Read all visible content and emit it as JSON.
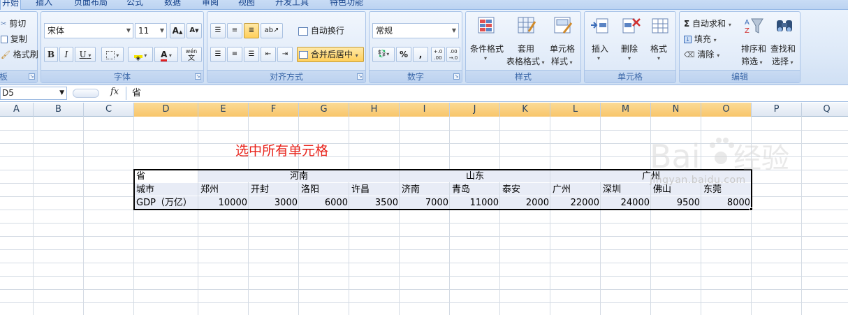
{
  "tabs": [
    "开始",
    "插入",
    "页面布局",
    "公式",
    "数据",
    "审阅",
    "视图",
    "开发工具",
    "特色功能"
  ],
  "clipboard": {
    "cut": "剪切",
    "copy": "复制",
    "format_painter": "格式刷",
    "group_label": "板"
  },
  "font": {
    "name": "宋体",
    "size": "11",
    "bold": "B",
    "italic": "I",
    "underline": "U",
    "grow": "A",
    "shrink": "A",
    "wen": "wén",
    "wen_char": "文",
    "group_label": "字体"
  },
  "alignment": {
    "wrap_text": "自动换行",
    "merge_center": "合并后居中",
    "group_label": "对齐方式"
  },
  "number": {
    "format": "常规",
    "percent": "%",
    "comma": ",",
    "inc_decimal": "+.0 .00",
    "dec_decimal": ".00 →.0",
    "group_label": "数字"
  },
  "styles": {
    "conditional": "条件格式",
    "table_format_1": "套用",
    "table_format_2": "表格格式",
    "cell_style_1": "单元格",
    "cell_style_2": "样式",
    "group_label": "样式"
  },
  "cells": {
    "insert": "插入",
    "delete": "删除",
    "format": "格式",
    "group_label": "单元格"
  },
  "editing": {
    "autosum": "自动求和",
    "fill": "填充",
    "clear": "清除",
    "sort_1": "排序和",
    "sort_2": "筛选",
    "find_1": "查找和",
    "find_2": "选择",
    "group_label": "编辑",
    "sigma": "Σ"
  },
  "formula_bar": {
    "name_box": "D5",
    "fx": "fx",
    "content": "省"
  },
  "columns": [
    "A",
    "B",
    "C",
    "D",
    "E",
    "F",
    "G",
    "H",
    "I",
    "J",
    "K",
    "L",
    "M",
    "N",
    "O",
    "P",
    "Q"
  ],
  "selected_columns": [
    "D",
    "E",
    "F",
    "G",
    "H",
    "I",
    "J",
    "K",
    "L",
    "M",
    "N",
    "O"
  ],
  "note": "选中所有单元格",
  "sheet": {
    "row_province": {
      "label": "省",
      "henan": "河南",
      "shandong": "山东",
      "guangdong": "广州"
    },
    "row_city": {
      "label": "城市",
      "cities": [
        "郑州",
        "开封",
        "洛阳",
        "许昌",
        "济南",
        "青岛",
        "泰安",
        "广州",
        "深圳",
        "佛山",
        "东莞"
      ]
    },
    "row_gdp": {
      "label": "GDP（万亿）",
      "values": [
        "10000",
        "3000",
        "6000",
        "3500",
        "7000",
        "11000",
        "2000",
        "22000",
        "24000",
        "9500",
        "8000"
      ]
    }
  },
  "watermark": {
    "brand": "Bai",
    "brand_cn": "经验",
    "url": "jingyan.baidu.com"
  }
}
